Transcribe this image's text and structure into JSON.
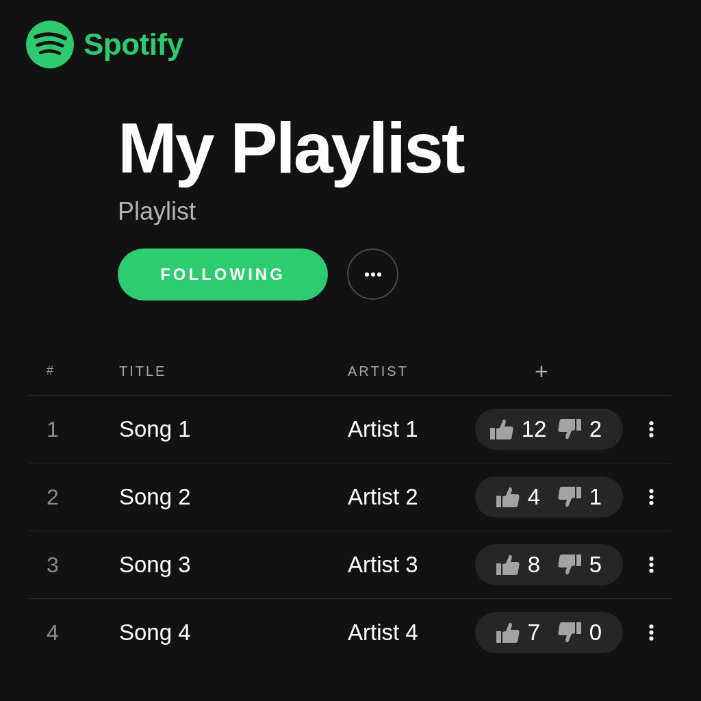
{
  "header": {
    "brand": "Spotify"
  },
  "playlist": {
    "title": "My Playlist",
    "type": "Playlist",
    "follow_button": "FOLLOWING"
  },
  "table": {
    "columns": [
      {
        "label": "#",
        "kind": "text"
      },
      {
        "label": "TITLE",
        "kind": "text"
      },
      {
        "label": "ARTIST",
        "kind": "text"
      },
      {
        "label": "+",
        "kind": "button"
      }
    ],
    "rows": [
      {
        "number": "1",
        "title": "Song 1",
        "artist": "Artist 1",
        "likes": "12",
        "dislikes": "2"
      },
      {
        "number": "2",
        "title": "Song 2",
        "artist": "Artist 2",
        "likes": "4",
        "dislikes": "1"
      },
      {
        "number": "3",
        "title": "Song 3",
        "artist": "Artist 3",
        "likes": "8",
        "dislikes": "5"
      },
      {
        "number": "4",
        "title": "Song 4",
        "artist": "Artist 4",
        "likes": "7",
        "dislikes": "0"
      }
    ]
  }
}
